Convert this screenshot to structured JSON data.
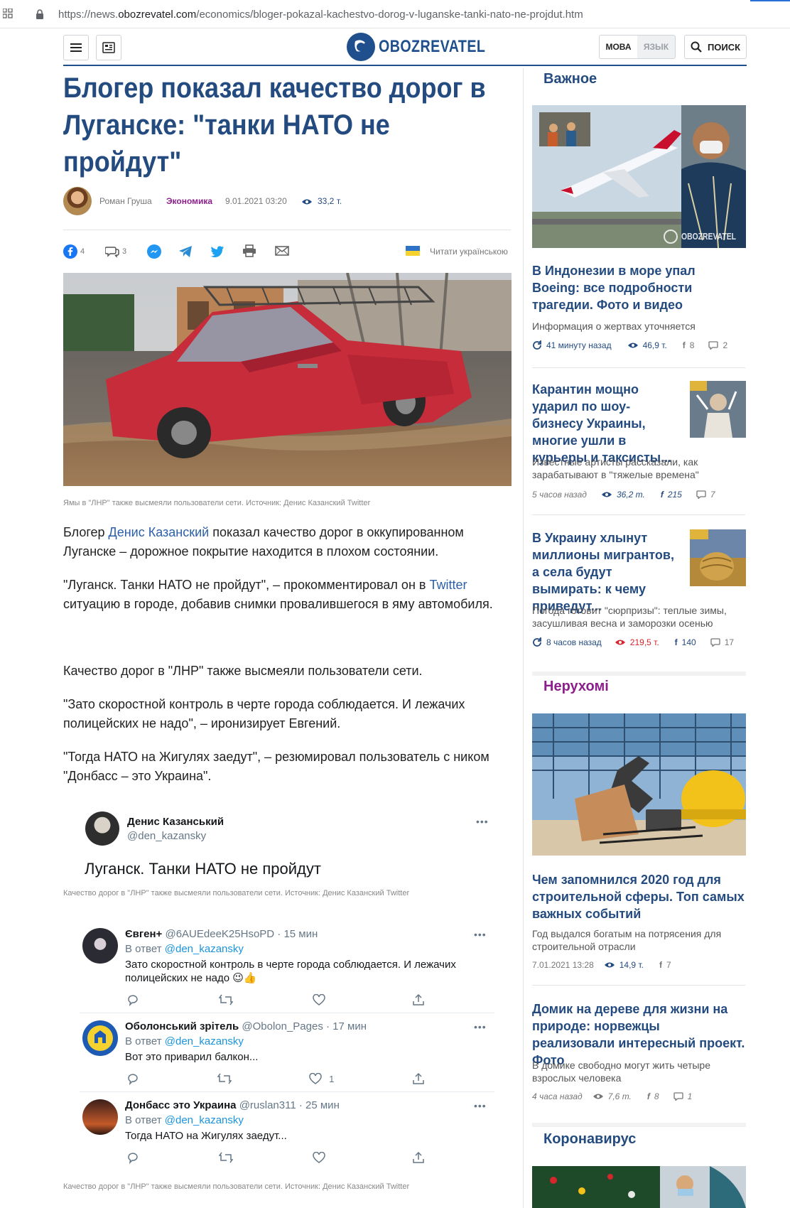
{
  "browser": {
    "url_prefix": "https://news.",
    "url_domain": "obozrevatel.com",
    "url_path": "/economics/bloger-pokazal-kachestvo-dorog-v-luganske-tanki-nato-ne-projdut.htm"
  },
  "header": {
    "logo_text": "OBOZREVATEL",
    "lang_ua": "МОВА",
    "lang_ru": "ЯЗЫК",
    "search_label": "ПОИСК"
  },
  "article": {
    "title": "Блогер показал качество дорог в Луганске: \"танки НАТО не пройдут\"",
    "author": "Роман Груша",
    "category": "Экономика",
    "date": "9.01.2021 03:20",
    "views": "33,2 т.",
    "share": {
      "facebook_count": "4",
      "comments_count": "3",
      "read_ukrainian": "Читати українською"
    },
    "photo_caption": "Ямы в \"ЛНР\" также высмеяли пользователи сети. Источник: Денис Казанский Twitter",
    "p1_a": "Блогер ",
    "p1_link": "Денис Казанский",
    "p1_b": " показал качество дорог в оккупированном Луганске – дорожное покрытие находится в плохом состоянии.",
    "p2_a": "\"Луганск. Танки НАТО не пройдут\", – прокомментировал он в ",
    "p2_link": "Twitter",
    "p2_b": " ситуацию в городе, добавив снимки провалившегося в яму автомобиля.",
    "p3": "Качество дорог в \"ЛНР\" также высмеяли пользователи сети.",
    "p4": "\"Зато скоростной контроль в черте города соблюдается. И лежачих полицейских не надо\", – иронизирует Евгений.",
    "p5": "\"Тогда НАТО на Жигулях заедут\", – резюмировал пользователь с ником \"Донбасс – это Украина\"."
  },
  "tweet": {
    "name": "Денис Казанський",
    "handle": "@den_kazansky",
    "text": "Луганск. Танки НАТО не пройдут",
    "caption": "Качество дорог в \"ЛНР\" также высмеяли пользователи сети. Источник: Денис Казанский Twitter",
    "more": "•••"
  },
  "replies": [
    {
      "name": "Євген+",
      "handle": "@6AUEdeeK25HsoPD",
      "time": "· 15 мин",
      "reply_prefix": "В ответ ",
      "reply_to": "@den_kazansky",
      "text": "Зато скоростной контроль в черте города соблюдается. И лежачих полицейских не надо 😉👍",
      "likes": ""
    },
    {
      "name": "Оболонський зрітель",
      "handle": "@Obolon_Pages",
      "time": "· 17 мин",
      "reply_prefix": "В ответ ",
      "reply_to": "@den_kazansky",
      "text": "Вот это приварил балкон...",
      "likes": "1"
    },
    {
      "name": "Донбасс это Украина",
      "handle": "@ruslan311",
      "time": "· 25 мин",
      "reply_prefix": "В ответ ",
      "reply_to": "@den_kazansky",
      "text": "Тогда НАТО на Жигулях заедут...",
      "likes": ""
    }
  ],
  "replies_caption": "Качество дорог в \"ЛНР\" также высмеяли пользователи сети. Источник: Денис Казанский Twitter",
  "sidebar": {
    "important_title": "Важное",
    "watermark": "OBOZREVATEL",
    "items": [
      {
        "title": "В Индонезии в море упал Boeing: все подробности трагедии. Фото и видео",
        "desc": "Информация о жертвах уточняется",
        "time": "41 минуту назад",
        "views": "46,9 т.",
        "fb": "8",
        "comments": "2"
      },
      {
        "title": "Карантин мощно ударил по шоу-бизнесу Украины, многие ушли в курьеры и таксисты...",
        "desc": "Известные артисты рассказали, как зарабатывают в \"тяжелые времена\"",
        "time": "5 часов назад",
        "views": "36,2 т.",
        "fb": "215",
        "comments": "7"
      },
      {
        "title": "В Украину хлынут миллионы мигрантов, а села будут вымирать: к чему приведут...",
        "desc": "Погода готовит \"сюрпризы\": теплые зимы, засушливая весна и заморозки осенью",
        "time": "8 часов назад",
        "views": "219,5 т.",
        "fb": "140",
        "comments": "17"
      }
    ],
    "realty_title": "Нерухомі",
    "realty_items": [
      {
        "title": "Чем запомнился 2020 год для строительной сферы. Топ самых важных событий",
        "desc": "Год выдался богатым на потрясения для строительной отрасли",
        "time": "7.01.2021 13:28",
        "views": "14,9 т.",
        "fb": "7"
      },
      {
        "title": "Домик на дереве для жизни на природе: норвежцы реализовали интересный проект. Фото",
        "desc": "В домике свободно могут жить четыре взрослых человека",
        "time": "4 часа назад",
        "views": "7,6 т.",
        "fb": "8",
        "comments": "1"
      }
    ],
    "covid_title": "Коронавирус"
  },
  "colors": {
    "brand_blue": "#244b80",
    "accent_purple": "#8c1f8c",
    "hot_red": "#d6252b",
    "link_blue": "#2b5fa8",
    "twitter_blue": "#1b95e0"
  }
}
